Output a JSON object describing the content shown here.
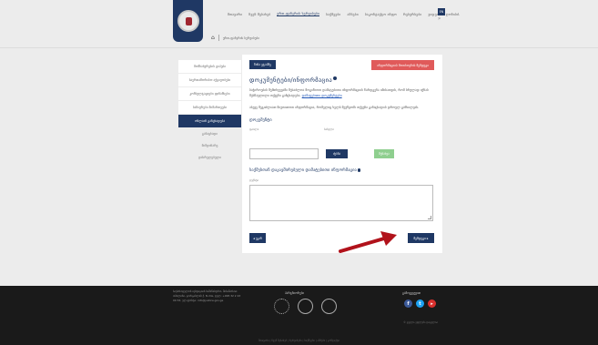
{
  "header": {
    "nav": [
      "მთავარი",
      "ჩვენ შესახებ",
      "ერთ-ფანჯრის სერვისები",
      "საქმეები",
      "ამბები",
      "საკონტაქტო ინფო",
      "რესურსები",
      "ვიდეო",
      "ღონისძ."
    ],
    "nav_active_index": 2,
    "lang": "EN",
    "lang_sub": "ქა",
    "breadcrumb": "ერთ-ფანჯრის სერვისები"
  },
  "sidebar": {
    "items": [
      "მომსახურების ტიპები",
      "საერთაშორისო აქტივობები",
      "კონსულტაციები ფინანსები",
      "საჩივრები მიმართვები",
      "ონლაინ განცხადება"
    ],
    "active_index": 4,
    "sub_items": [
      "განაცხადი",
      "მიმდინარე",
      "დასრულებული"
    ]
  },
  "form": {
    "prev_top": "წინა ეტაპზე",
    "red_button": "ინფორმაციის მოთხოვნის შემდეგი",
    "title": "დოკუმენტები/ინფორმაცია",
    "para1": "საჭიროების შემთხვევაში შესაძლოა მოგიწიოთ დამატებითი ინფორმაციის წარდგენა იმისათვის, რომ სრულად იქნას შესწავლილი თქვენი განცხადება.",
    "para1_link": "დამატებითი დოკუმენტები",
    "para2": "ასევე შეგიძლიათ მიუთითოთ ინფორმაცია, რომელიც ხელს შეუწყობს თქვენი განაცხადის დროულ განხილვას.",
    "subheading": "დოკუმენტი",
    "label_file": "ფაილი",
    "label_name": "სახელი",
    "search_button": "ძებნა",
    "green_button": "შენახვა",
    "section2": "საქმესთან დაკავშირებული დამატებითი ინფორმაცია",
    "label_comment": "ტექსტი",
    "back_button": "◂ უკან",
    "next_button": "შემდეგი ▸"
  },
  "footer": {
    "left_text": "საქართველოს იუსტიციის სამინისტრო, მისამართი: თბილისი, გორგასლის ქ. N 24ა, ტელ: +995 32 2 43 00 53, ელ.ფოსტა: info@justice.gov.ge",
    "center_title": "პარტნიორები",
    "right_title": "გამოგვყევით",
    "right_text": "© ყველა უფლება დაცულია",
    "bottom_text": "მთავარი | ჩვენ შესახებ | სერვისები | საქმეები | ამბები | კონტაქტი"
  },
  "colors": {
    "primary": "#1f3864",
    "accent_red": "#e05a5a",
    "accent_green": "#8fcf8f",
    "arrow": "#b1121b"
  }
}
